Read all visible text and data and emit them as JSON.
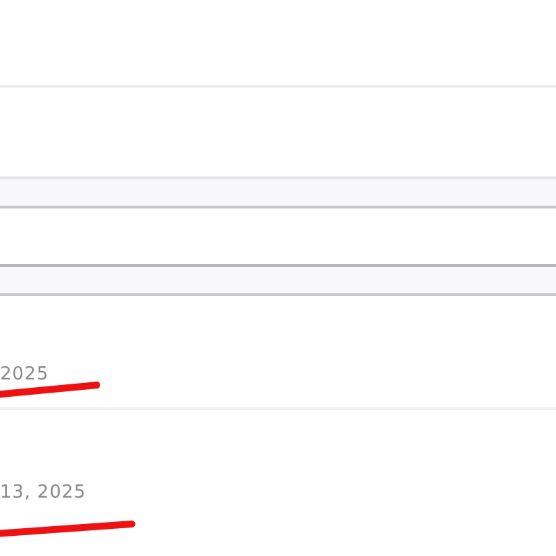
{
  "sections": [
    {
      "kind": "blank"
    },
    {
      "kind": "blank"
    },
    {
      "kind": "band"
    },
    {
      "kind": "blank"
    },
    {
      "kind": "band"
    }
  ],
  "rows": [
    {
      "date": "2025",
      "underlined": true
    },
    {
      "date": "13, 2025",
      "underlined": true
    }
  ]
}
